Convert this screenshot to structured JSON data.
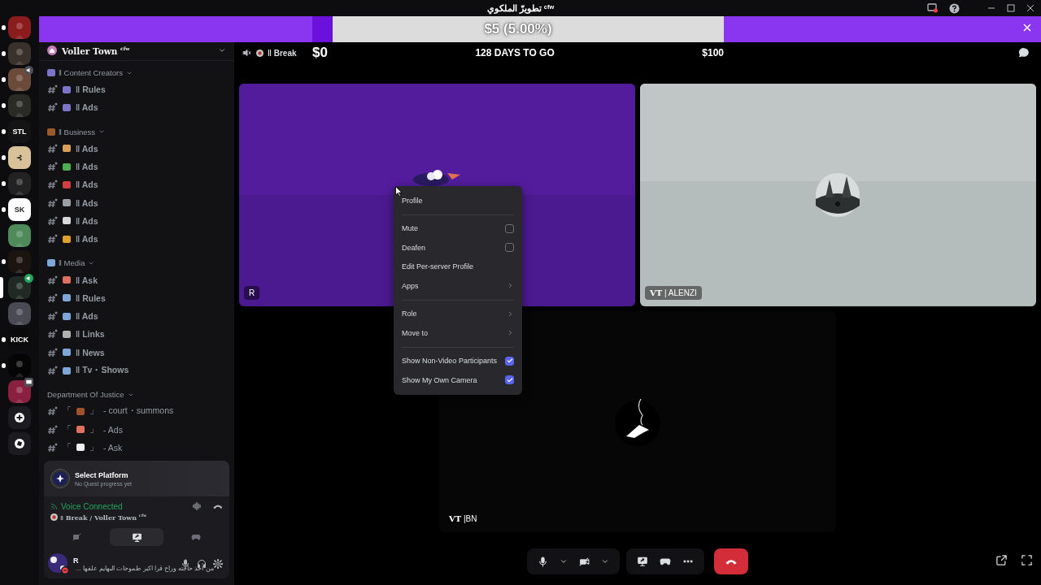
{
  "window": {
    "title": "تطويرّ الملكوي ᶜᶠʷ"
  },
  "servers": [
    {
      "kind": "picture",
      "color": "#8a1c1c",
      "unread": true,
      "selected": false
    },
    {
      "kind": "picture",
      "color": "#3a302c",
      "unread": true,
      "selected": false
    },
    {
      "kind": "picture",
      "color": "#6b4a3a",
      "unread": true,
      "selected": false,
      "in_voice": true
    },
    {
      "kind": "picture",
      "color": "#2a2a26",
      "unread": true,
      "selected": false
    },
    {
      "kind": "logo",
      "label": "STL",
      "color": "#141414",
      "unread": true,
      "selected": false
    },
    {
      "kind": "logo",
      "label": "⊰",
      "color": "#d9c19a",
      "unread": true,
      "selected": false
    },
    {
      "kind": "picture",
      "color": "#222222",
      "unread": true,
      "selected": false
    },
    {
      "kind": "logo",
      "label": "SK",
      "color": "#ffffff",
      "unread": true,
      "selected": false
    },
    {
      "kind": "picture",
      "color": "#4f8a5a",
      "unread": false,
      "selected": false
    },
    {
      "kind": "picture",
      "color": "#1c1410",
      "unread": true,
      "selected": false
    },
    {
      "kind": "picture",
      "color": "#1f2a24",
      "selected": true,
      "in_voice": true
    },
    {
      "kind": "picture",
      "color": "#4a4a55",
      "unread": false,
      "selected": false
    },
    {
      "kind": "logo",
      "label": "KICK",
      "color": "#0b0b0b",
      "unread": true,
      "selected": false
    },
    {
      "kind": "picture",
      "color": "#050505",
      "unread": true,
      "selected": false
    },
    {
      "kind": "picture",
      "color": "#8a2040",
      "unread": false,
      "selected": false,
      "streaming": true
    },
    {
      "kind": "add"
    },
    {
      "kind": "discover"
    }
  ],
  "banner": {
    "text": "$5 (5.00%)",
    "level": 0.05,
    "start": "$0",
    "countdown": "128 DAYS TO GO",
    "goal": "$100"
  },
  "server": {
    "name": "Voller Town $^{cfw}$"
  },
  "categories": [
    {
      "name": "ǁ Content Creators",
      "color": "#7b74c9",
      "channels": [
        {
          "name": "ǁ Rules",
          "color": "#7b74c9"
        },
        {
          "name": "ǁ Ads",
          "color": "#7b74c9"
        }
      ]
    },
    {
      "name": "ǁ Business",
      "color": "#9a5a2a",
      "channels": [
        {
          "name": "ǁ Ads",
          "color": "#d9a05b"
        },
        {
          "name": "ǁ Ads",
          "color": "#4caf50"
        },
        {
          "name": "ǁ Ads",
          "color": "#d04040"
        },
        {
          "name": "ǁ Ads",
          "color": "#9aa0a6"
        },
        {
          "name": "ǁ Ads",
          "color": "#d8d8d8"
        },
        {
          "name": "ǁ Ads",
          "color": "#e0a030"
        }
      ]
    },
    {
      "name": "ǁ Media",
      "color": "#7da7d9",
      "channels": [
        {
          "name": "ǁ Ask",
          "color": "#e07060"
        },
        {
          "name": "ǁ Rules",
          "color": "#7da7d9"
        },
        {
          "name": "ǁ Ads",
          "color": "#7da7d9"
        },
        {
          "name": "ǁ Links",
          "color": "#b0b0b0"
        },
        {
          "name": "ǁ News",
          "color": "#7da7d9"
        },
        {
          "name": "ǁ Tv・Shows",
          "color": "#7da7d9"
        }
      ]
    },
    {
      "name": "Department Of Justice",
      "channels": [
        {
          "open": "「",
          "close": "」",
          "name": "- court・summons",
          "color": "#a0522d"
        },
        {
          "open": "「",
          "close": "」",
          "name": "- Ads",
          "color": "#e07060"
        },
        {
          "open": "「",
          "close": "」",
          "name": "- Ask",
          "color": "#f0f0f0"
        }
      ]
    }
  ],
  "quest": {
    "title": "Select Platform",
    "subtitle": "No Quest progress yet"
  },
  "voice": {
    "status": "Voice Connected",
    "channel": "ǁ Break / Voller Town $^{cfw}$"
  },
  "user": {
    "name": "R",
    "status": "من أخذ حاجته وراح قرا اكبر طموحات البهايم علفها ..."
  },
  "call": {
    "channel": "ǁ Break"
  },
  "tiles": [
    {
      "kind": "purple",
      "label": "R"
    },
    {
      "kind": "grey",
      "label": "**VT** | ALENZI"
    },
    {
      "kind": "dark",
      "label": "**VT** |BN"
    }
  ],
  "context_menu": {
    "items": [
      {
        "kind": "item",
        "label": "Profile"
      },
      {
        "kind": "separator"
      },
      {
        "kind": "checkbox",
        "label": "Mute",
        "checked": false
      },
      {
        "kind": "checkbox",
        "label": "Deafen",
        "checked": false
      },
      {
        "kind": "item",
        "label": "Edit Per-server Profile"
      },
      {
        "kind": "submenu",
        "label": "Apps"
      },
      {
        "kind": "separator"
      },
      {
        "kind": "submenu",
        "label": "Role"
      },
      {
        "kind": "submenu",
        "label": "Move to"
      },
      {
        "kind": "separator"
      },
      {
        "kind": "checkbox",
        "label": "Show Non-Video Participants",
        "checked": true
      },
      {
        "kind": "checkbox",
        "label": "Show My Own Camera",
        "checked": true
      }
    ]
  }
}
